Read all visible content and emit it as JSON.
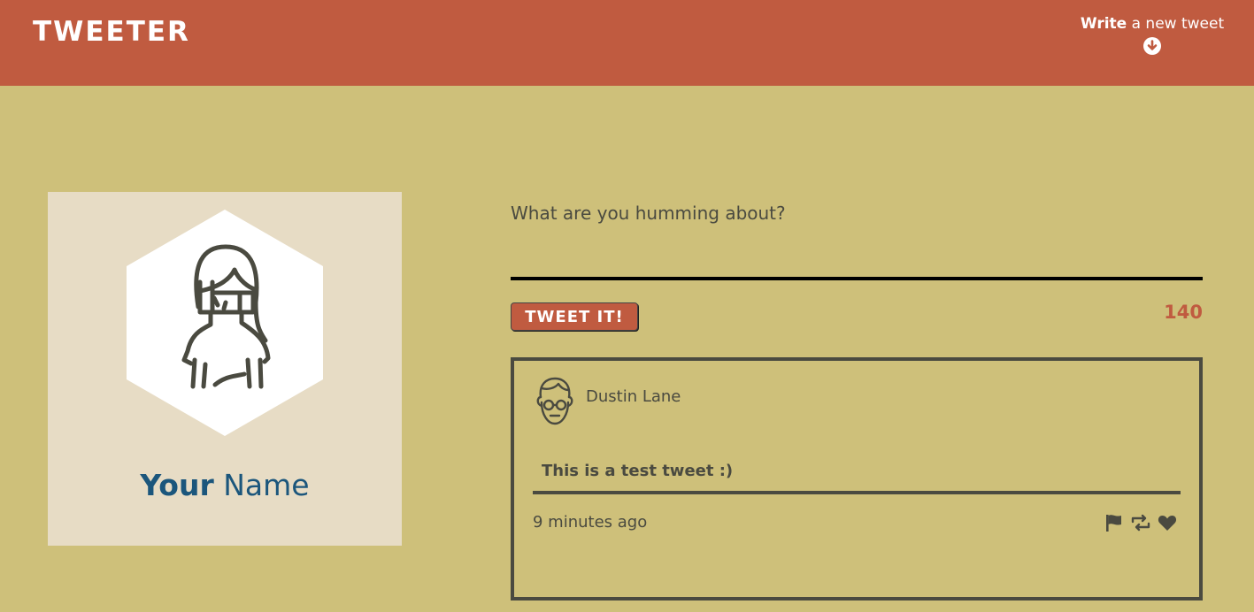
{
  "header": {
    "logo": "TWEETER",
    "compose_bold": "Write",
    "compose_rest": " a new tweet",
    "compose_icon": "arrow-circle-down-icon"
  },
  "profile": {
    "avatar_icon": "woman-avatar-icon",
    "first_name": "Your",
    "last_name": " Name"
  },
  "composer": {
    "placeholder": "What are you humming about?",
    "value": "",
    "submit_label": "TWEET IT!",
    "char_count": "140"
  },
  "tweets": [
    {
      "avatar_icon": "man-glasses-avatar-icon",
      "author": "Dustin Lane",
      "text": "This is a test tweet :)",
      "time": "9 minutes ago",
      "actions": [
        "flag-icon",
        "retweet-icon",
        "heart-icon"
      ]
    }
  ],
  "colors": {
    "background": "#cec07a",
    "header": "#c05b40",
    "profile_card": "#e7dcc5",
    "name": "#1b567c",
    "text": "#4a4a40",
    "accent": "#c05b40"
  }
}
